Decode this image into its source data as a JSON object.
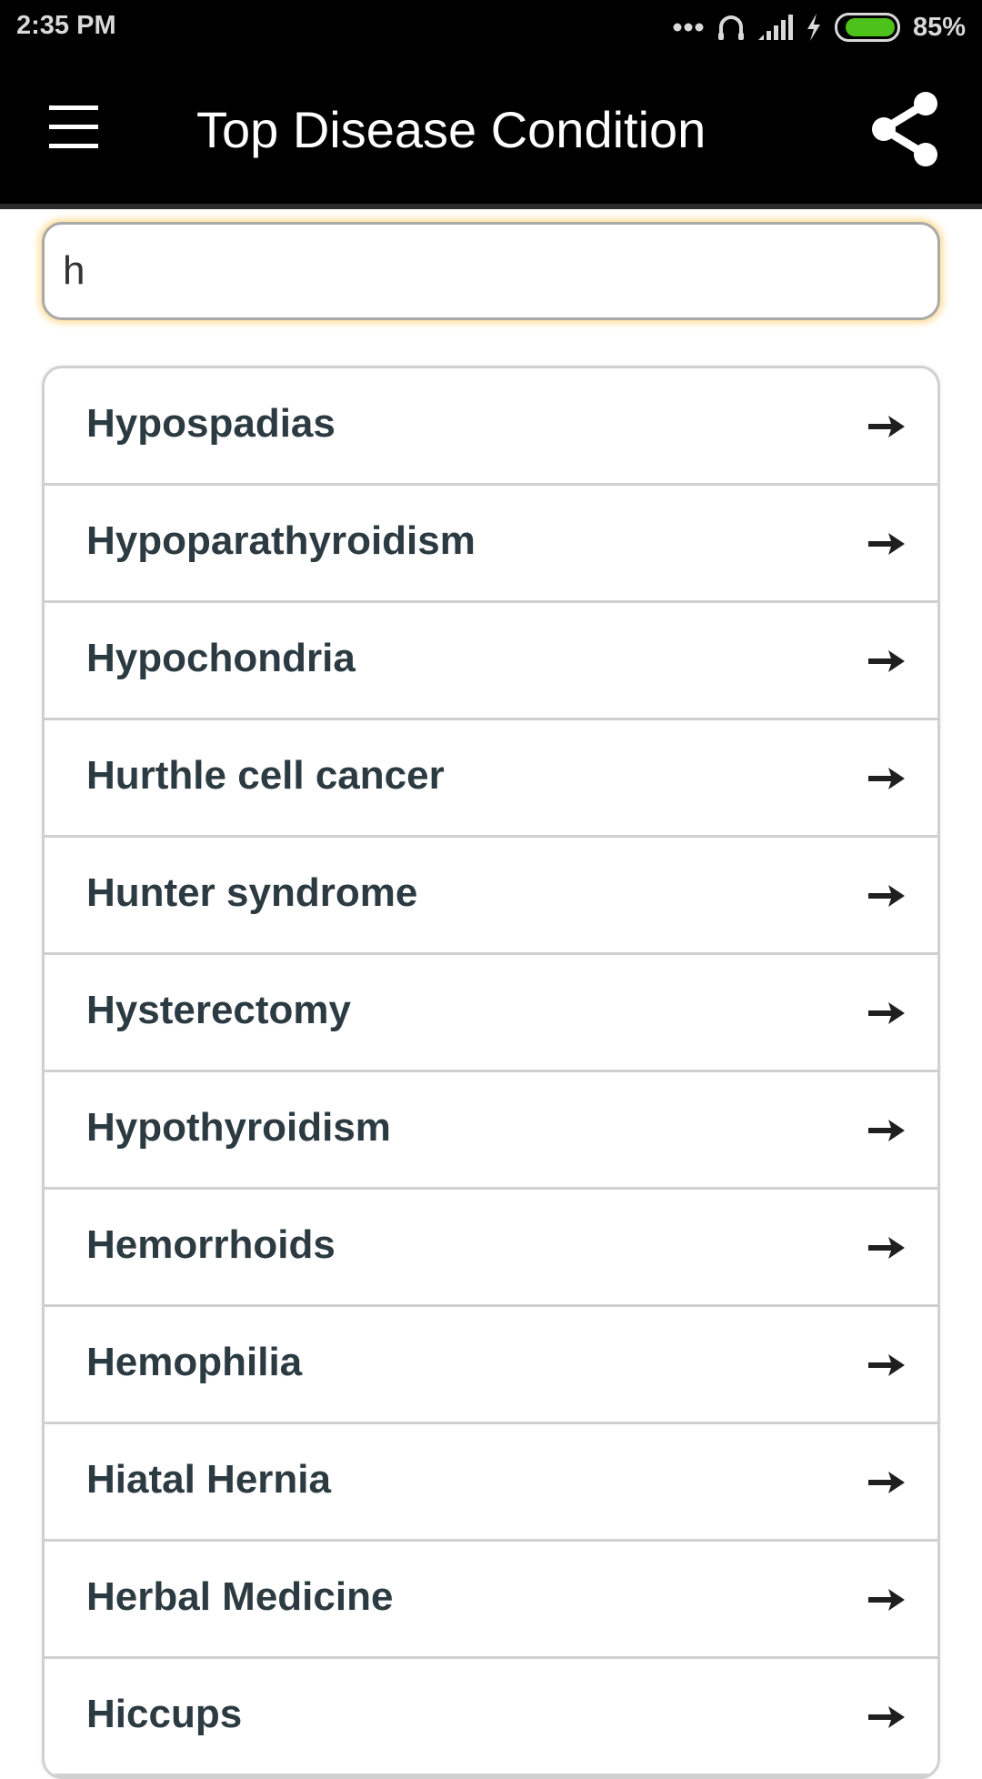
{
  "status_bar": {
    "time": "2:35 PM",
    "battery_percent": "85%",
    "battery_level": 0.85,
    "icons": [
      "more-dots-icon",
      "headphones-icon",
      "signal-icon",
      "charging-icon",
      "battery-icon"
    ],
    "battery_color": "#4cc21a"
  },
  "app_bar": {
    "title": "Top Disease Condition",
    "menu_icon": "hamburger-menu-icon",
    "share_icon": "share-icon"
  },
  "search": {
    "value": "h",
    "focus_glow_color": "#ffc85a"
  },
  "results": {
    "arrow_icon": "arrow-right-icon",
    "items": [
      {
        "label": "Hypospadias"
      },
      {
        "label": "Hypoparathyroidism"
      },
      {
        "label": "Hypochondria"
      },
      {
        "label": "Hurthle cell cancer"
      },
      {
        "label": "Hunter syndrome"
      },
      {
        "label": "Hysterectomy"
      },
      {
        "label": "Hypothyroidism"
      },
      {
        "label": "Hemorrhoids"
      },
      {
        "label": "Hemophilia"
      },
      {
        "label": "Hiatal Hernia"
      },
      {
        "label": "Herbal Medicine"
      },
      {
        "label": "Hiccups"
      }
    ]
  }
}
